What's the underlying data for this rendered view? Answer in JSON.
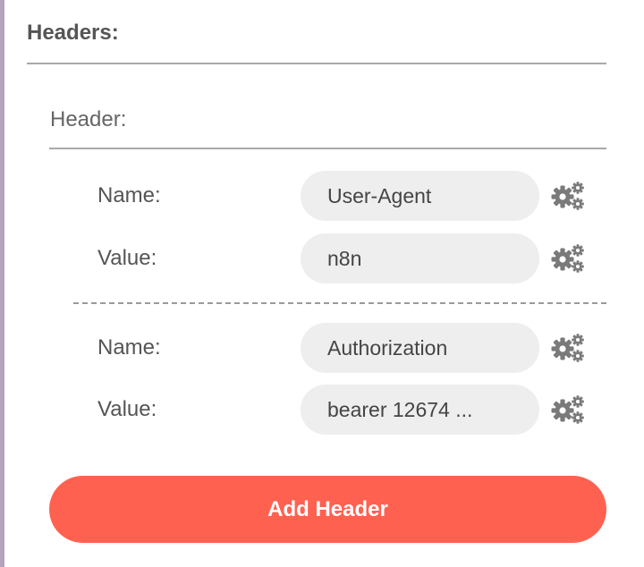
{
  "section": {
    "title": "Headers:"
  },
  "header_group": {
    "title": "Header:",
    "entries": [
      {
        "name_label": "Name:",
        "name_value": "User-Agent",
        "value_label": "Value:",
        "value_value": "n8n"
      },
      {
        "name_label": "Name:",
        "name_value": "Authorization",
        "value_label": "Value:",
        "value_value": "bearer 12674  ..."
      }
    ]
  },
  "icons": {
    "parameter_options": "gears-icon"
  },
  "colors": {
    "accent": "#ff6150",
    "input_background": "#eeeeee",
    "text": "#555555",
    "left_border": "#b3a3bc"
  },
  "add_button": {
    "label": "Add Header"
  }
}
